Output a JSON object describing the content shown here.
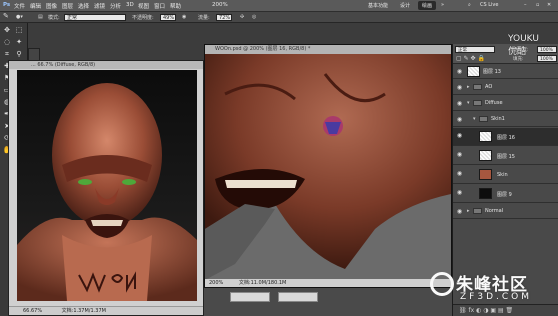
{
  "menubar": {
    "items": [
      "文件",
      "编辑",
      "图像",
      "图层",
      "选择",
      "滤镜",
      "分析",
      "3D",
      "视图",
      "窗口",
      "帮助"
    ],
    "zoom": "200%",
    "workspaces": [
      "基本功能",
      "设计",
      "绘画"
    ],
    "active_workspace": "绘画",
    "cs_live": "CS Live"
  },
  "options": {
    "mode_label": "模式:",
    "mode_value": "正常",
    "opacity_label": "不透明度:",
    "opacity_value": "49%",
    "flow_label": "流量:",
    "flow_value": "72%"
  },
  "doc1": {
    "title": "... 66.7% (Diffuse, RGB/8)",
    "status": "文档:1.37M/1.37M",
    "zoom": "66.67%"
  },
  "doc2": {
    "title": "WOOn.psd @ 200% (图层 16, RGB/8) *",
    "status": "文档:11.0M/180.1M",
    "zoom": "200%"
  },
  "layers": {
    "blend_mode": "正常",
    "opacity_label": "不透明度:",
    "opacity_value": "100%",
    "fill_label": "填充:",
    "fill_value": "100%",
    "rows": [
      {
        "name": "图层 13",
        "type": "layer",
        "indent": 0,
        "selected": false
      },
      {
        "name": "AO",
        "type": "group",
        "indent": 0,
        "selected": false
      },
      {
        "name": "Diffuse",
        "type": "group",
        "indent": 0,
        "selected": false
      },
      {
        "name": "Skin1",
        "type": "group",
        "indent": 1,
        "selected": false
      },
      {
        "name": "图层 16",
        "type": "layer",
        "indent": 2,
        "selected": true
      },
      {
        "name": "图层 15",
        "type": "layer",
        "indent": 2,
        "selected": false
      },
      {
        "name": "Skin",
        "type": "layer",
        "indent": 2,
        "selected": false
      },
      {
        "name": "图层 9",
        "type": "layer",
        "indent": 2,
        "selected": false
      },
      {
        "name": "Normal",
        "type": "group",
        "indent": 0,
        "selected": false
      }
    ]
  },
  "watermarks": {
    "youku_top": "YOUKU",
    "youku_bottom": "优酷",
    "zf3d_main": "朱峰社区",
    "zf3d_sub": "ZF3D.COM"
  },
  "colors": {
    "foreground": "#c4574a",
    "selected_layer": "#2d2d2d"
  }
}
